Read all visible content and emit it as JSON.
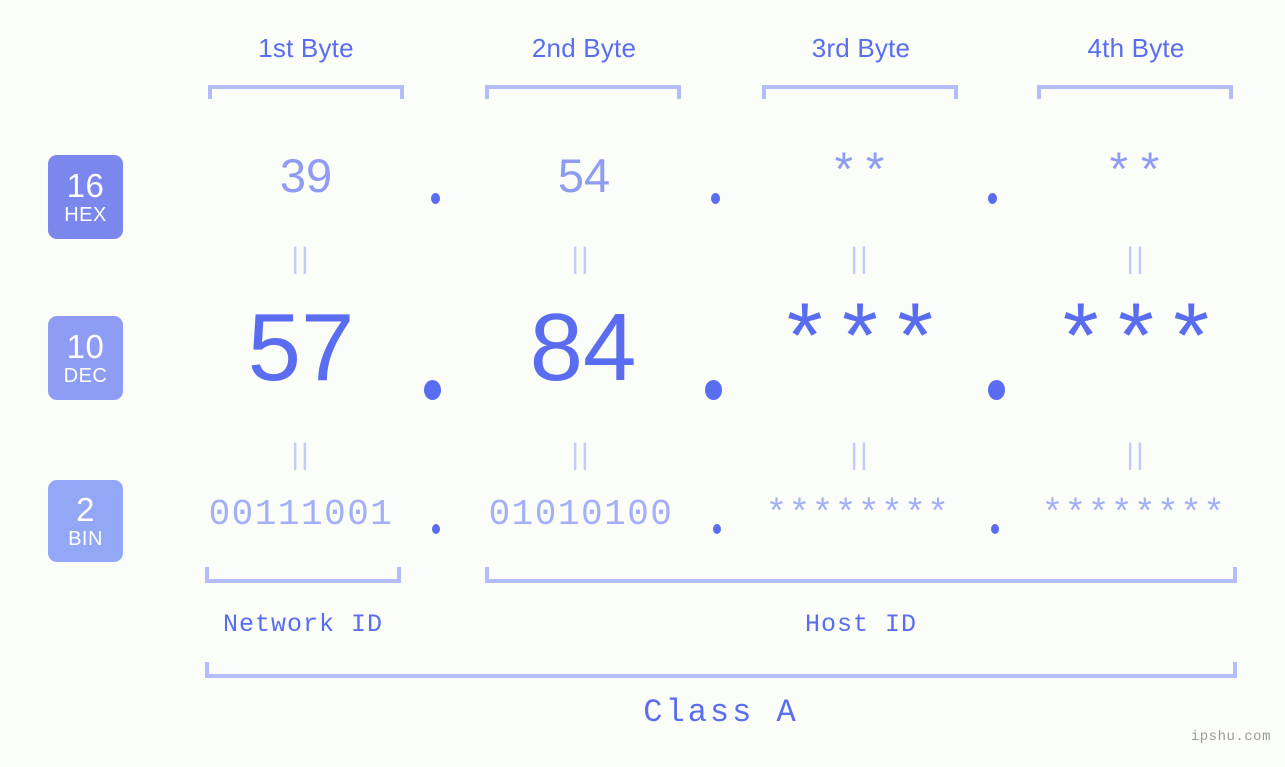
{
  "watermark": "ipshu.com",
  "byte_headers": [
    {
      "label": "1st Byte"
    },
    {
      "label": "2nd Byte"
    },
    {
      "label": "3rd Byte"
    },
    {
      "label": "4th Byte"
    }
  ],
  "bases": [
    {
      "radix": "16",
      "abbr": "HEX"
    },
    {
      "radix": "10",
      "abbr": "DEC"
    },
    {
      "radix": "2",
      "abbr": "BIN"
    }
  ],
  "rows": {
    "hex": {
      "values": [
        "39",
        "54",
        "**",
        "**"
      ],
      "separator": "."
    },
    "dec": {
      "values": [
        "57",
        "84",
        "***",
        "***"
      ],
      "separator": "."
    },
    "bin": {
      "values": [
        "00111001",
        "01010100",
        "********",
        "********"
      ],
      "separator": "."
    }
  },
  "equals_marks": [
    "||",
    "||",
    "||",
    "||",
    "||",
    "||",
    "||",
    "||"
  ],
  "segments": [
    {
      "label": "Network ID"
    },
    {
      "label": "Host ID"
    }
  ],
  "class": {
    "label": "Class A"
  },
  "colors": {
    "background": "#fbfdf8",
    "accent_strong": "#5a6df0",
    "accent_mid": "#8f9cf3",
    "accent_light": "#b3bdfa",
    "badge_hex": "#7b87ed",
    "badge_dec": "#8f9cf3",
    "badge_bin": "#92a7f5",
    "watermark": "#9b9b9b"
  }
}
